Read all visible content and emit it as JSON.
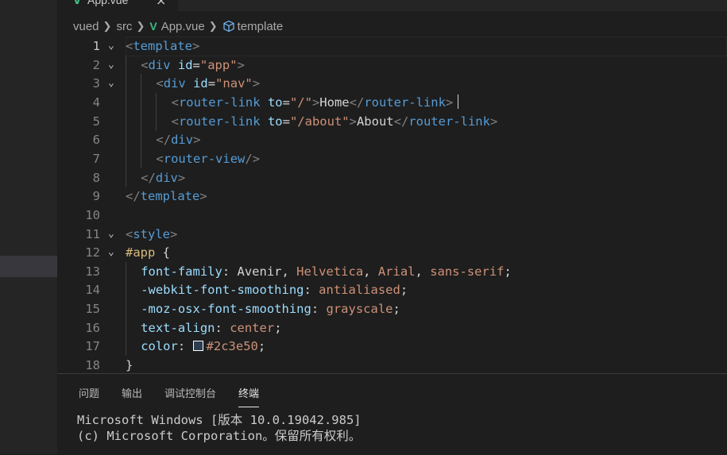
{
  "tab": {
    "label": "App.vue",
    "close": "×"
  },
  "breadcrumb": {
    "items": [
      "vued",
      "src",
      "App.vue",
      "template"
    ]
  },
  "editor": {
    "lines": [
      {
        "num": "1",
        "tokens": [
          [
            "t-p",
            "<"
          ],
          [
            "t-tag",
            "template"
          ],
          [
            "t-p",
            ">"
          ]
        ]
      },
      {
        "num": "2",
        "tokens": [
          [
            "t-p",
            "<"
          ],
          [
            "t-tag",
            "div"
          ],
          [
            "t-txt",
            " "
          ],
          [
            "t-attr",
            "id"
          ],
          [
            "t-txt",
            "="
          ],
          [
            "t-str",
            "\"app\""
          ],
          [
            "t-p",
            ">"
          ]
        ]
      },
      {
        "num": "3",
        "tokens": [
          [
            "t-p",
            "<"
          ],
          [
            "t-tag",
            "div"
          ],
          [
            "t-txt",
            " "
          ],
          [
            "t-attr",
            "id"
          ],
          [
            "t-txt",
            "="
          ],
          [
            "t-str",
            "\"nav\""
          ],
          [
            "t-p",
            ">"
          ]
        ]
      },
      {
        "num": "4",
        "tokens": [
          [
            "t-p",
            "<"
          ],
          [
            "t-tag",
            "router-link"
          ],
          [
            "t-txt",
            " "
          ],
          [
            "t-attr",
            "to"
          ],
          [
            "t-txt",
            "="
          ],
          [
            "t-str",
            "\"/\""
          ],
          [
            "t-p",
            ">"
          ],
          [
            "t-txt",
            "Home"
          ],
          [
            "t-p",
            "</"
          ],
          [
            "t-tag",
            "router-link"
          ],
          [
            "t-p",
            ">"
          ]
        ]
      },
      {
        "num": "5",
        "tokens": [
          [
            "t-p",
            "<"
          ],
          [
            "t-tag",
            "router-link"
          ],
          [
            "t-txt",
            " "
          ],
          [
            "t-attr",
            "to"
          ],
          [
            "t-txt",
            "="
          ],
          [
            "t-str",
            "\"/about\""
          ],
          [
            "t-p",
            ">"
          ],
          [
            "t-txt",
            "About"
          ],
          [
            "t-p",
            "</"
          ],
          [
            "t-tag",
            "router-link"
          ],
          [
            "t-p",
            ">"
          ]
        ]
      },
      {
        "num": "6",
        "tokens": [
          [
            "t-p",
            "</"
          ],
          [
            "t-tag",
            "div"
          ],
          [
            "t-p",
            ">"
          ]
        ]
      },
      {
        "num": "7",
        "tokens": [
          [
            "t-p",
            "<"
          ],
          [
            "t-tag",
            "router-view"
          ],
          [
            "t-p",
            "/>"
          ]
        ]
      },
      {
        "num": "8",
        "tokens": [
          [
            "t-p",
            "</"
          ],
          [
            "t-tag",
            "div"
          ],
          [
            "t-p",
            ">"
          ]
        ]
      },
      {
        "num": "9",
        "tokens": [
          [
            "t-p",
            "</"
          ],
          [
            "t-tag",
            "template"
          ],
          [
            "t-p",
            ">"
          ]
        ]
      },
      {
        "num": "10",
        "tokens": []
      },
      {
        "num": "11",
        "tokens": [
          [
            "t-p",
            "<"
          ],
          [
            "t-tag",
            "style"
          ],
          [
            "t-p",
            ">"
          ]
        ]
      },
      {
        "num": "12",
        "tokens": [
          [
            "t-sel",
            "#app"
          ],
          [
            "t-txt",
            " {"
          ]
        ]
      },
      {
        "num": "13",
        "tokens": [
          [
            "t-prop",
            "font-family"
          ],
          [
            "t-txt",
            ": Avenir, "
          ],
          [
            "t-str",
            "Helvetica"
          ],
          [
            "t-txt",
            ", "
          ],
          [
            "t-str",
            "Arial"
          ],
          [
            "t-txt",
            ", "
          ],
          [
            "t-str",
            "sans-serif"
          ],
          [
            "t-txt",
            ";"
          ]
        ]
      },
      {
        "num": "14",
        "tokens": [
          [
            "t-prop",
            "-webkit-font-smoothing"
          ],
          [
            "t-txt",
            ": "
          ],
          [
            "t-str",
            "antialiased"
          ],
          [
            "t-txt",
            ";"
          ]
        ]
      },
      {
        "num": "15",
        "tokens": [
          [
            "t-prop",
            "-moz-osx-font-smoothing"
          ],
          [
            "t-txt",
            ": "
          ],
          [
            "t-str",
            "grayscale"
          ],
          [
            "t-txt",
            ";"
          ]
        ]
      },
      {
        "num": "16",
        "tokens": [
          [
            "t-prop",
            "text-align"
          ],
          [
            "t-txt",
            ": "
          ],
          [
            "t-str",
            "center"
          ],
          [
            "t-txt",
            ";"
          ]
        ]
      },
      {
        "num": "17",
        "tokens": [
          [
            "t-prop",
            "color"
          ],
          [
            "t-txt",
            ": "
          ],
          [
            "swatch",
            ""
          ],
          [
            "t-str",
            "#2c3e50"
          ],
          [
            "t-txt",
            ";"
          ]
        ]
      },
      {
        "num": "18",
        "tokens": [
          [
            "t-txt",
            "}"
          ]
        ]
      }
    ]
  },
  "panel": {
    "tabs": [
      "问题",
      "输出",
      "调试控制台",
      "终端"
    ],
    "terminal": [
      "Microsoft Windows [版本 10.0.19042.985]",
      "(c) Microsoft Corporation。保留所有权利。"
    ]
  },
  "colors": {
    "swatch": "#2c3e50",
    "vue": "#41b883"
  }
}
